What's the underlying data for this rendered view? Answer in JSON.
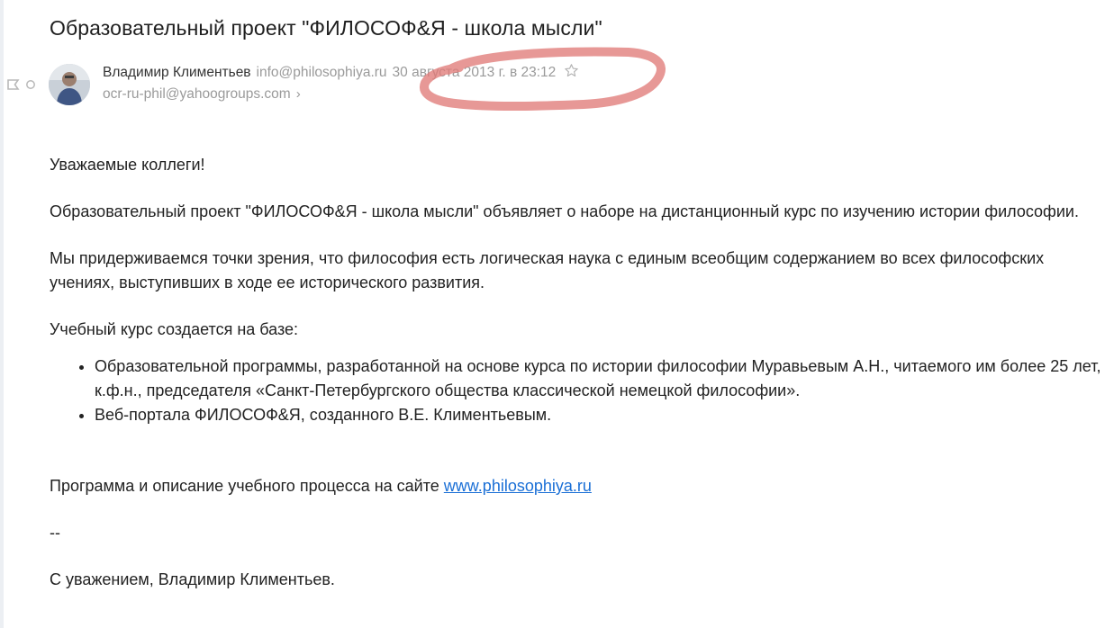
{
  "email": {
    "subject": "Образовательный проект \"ФИЛОСОФ&Я - школа мысли\"",
    "sender": {
      "name": "Владимир Климентьев",
      "email": "info@philosophiya.ru"
    },
    "date": "30 августа 2013 г. в 23:12",
    "recipient": "ocr-ru-phil@yahoogroups.com",
    "recipient_chevron": "›",
    "body": {
      "greeting": "Уважаемые коллеги!",
      "paragraph1": "Образовательный проект \"ФИЛОСОФ&Я - школа мысли\" объявляет о наборе на дистанционный курс по изучению истории философии.",
      "paragraph2": "Мы придерживаемся точки зрения, что философия есть логическая наука с единым всеобщим содержанием во всех философских учениях, выступивших в ходе ее исторического развития.",
      "paragraph3": "Учебный курс создается на базе:",
      "bullets": [
        "Образовательной программы, разработанной на основе курса по истории философии Муравьевым А.Н., читаемого им более 25 лет, к.ф.н., председателя «Санкт-Петербургского общества классической немецкой философии».",
        "Веб-портала ФИЛОСОФ&Я, созданного В.Е. Климентьевым."
      ],
      "program_text": "Программа и описание учебного процесса на сайте ",
      "program_link": "www.philosophiya.ru",
      "signature_dash": "--",
      "signature": "С уважением, Владимир Климентьев."
    }
  },
  "icons": {
    "flag": "flag-icon",
    "unread_dot": "unread-dot-icon",
    "star": "star-icon",
    "avatar": "avatar"
  },
  "colors": {
    "annotation": "#e07b78",
    "link": "#1a6fd6",
    "muted": "#9a9a9a"
  }
}
